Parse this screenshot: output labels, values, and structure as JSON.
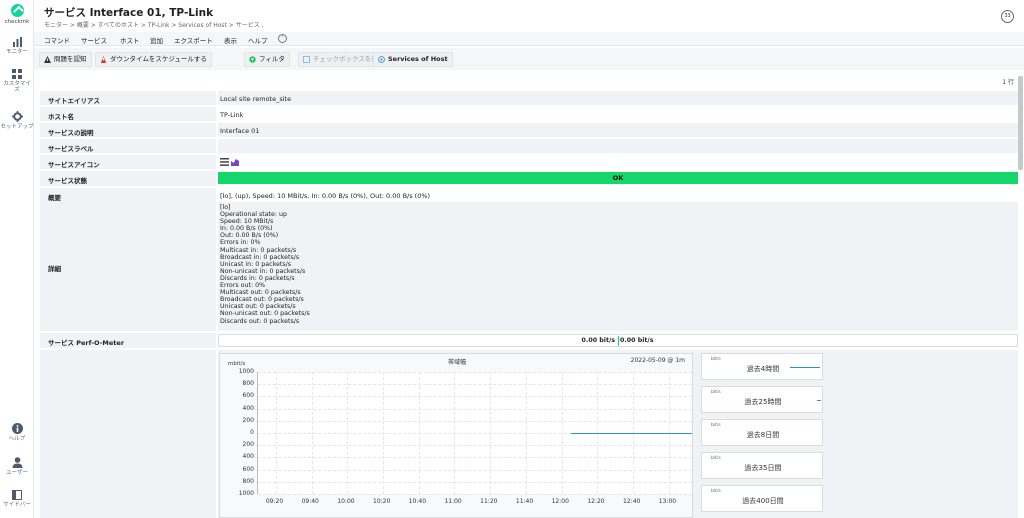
{
  "sidebar": {
    "logo_text": "checkmk",
    "items": [
      {
        "label": "モニター",
        "icon": "bar-chart-icon"
      },
      {
        "label": "カスタマイズ",
        "icon": "grid-icon"
      },
      {
        "label": "セットアップ",
        "icon": "gear-icon"
      },
      {
        "label": "ヘルプ",
        "icon": "info-icon"
      },
      {
        "label": "ユーザー",
        "icon": "user-icon"
      },
      {
        "label": "サイドバー",
        "icon": "sidebar-icon"
      }
    ]
  },
  "header": {
    "title": "サービス Interface 01, TP-Link",
    "breadcrumb": "モニター > 概要 > すべてのホスト > TP-Link > Services of Host > サービス .",
    "timer": "33"
  },
  "menu": {
    "items": [
      "コマンド",
      "サービス",
      "ホスト",
      "追加",
      "エクスポート",
      "表示",
      "ヘルプ"
    ],
    "toggle": "⌃"
  },
  "toolbar": {
    "ack": "問題を認知",
    "downtime": "ダウンタイムをスケジュールする",
    "filter": "フィルタ",
    "checkbox": "チェックボックスを表示する",
    "services_of_host": "Services of Host"
  },
  "row_count": "1 行",
  "table": {
    "site_alias": {
      "label": "サイトエイリアス",
      "value": "Local site remote_site"
    },
    "host_name": {
      "label": "ホスト名",
      "value": "TP-Link"
    },
    "service_desc": {
      "label": "サービスの説明",
      "value": "Interface 01"
    },
    "service_labels": {
      "label": "サービスラベル",
      "value": ""
    },
    "service_icons": {
      "label": "サービスアイコン"
    },
    "service_state": {
      "label": "サービス状態",
      "value": "OK"
    },
    "summary": {
      "label": "概要",
      "value": "[lo], (up), Speed: 10 MBit/s, In: 0.00 B/s (0%), Out: 0.00 B/s (0%)"
    },
    "details": {
      "label": "詳細",
      "lines": [
        "[lo]",
        "Operational state: up",
        "Speed: 10 MBit/s",
        "In: 0.00 B/s (0%)",
        "Out: 0.00 B/s (0%)",
        "Errors in: 0%",
        "Multicast in: 0 packets/s",
        "Broadcast in: 0 packets/s",
        "Unicast in: 0 packets/s",
        "Non-unicast in: 0 packets/s",
        "Discards in: 0 packets/s",
        "Errors out: 0%",
        "Multicast out: 0 packets/s",
        "Broadcast out: 0 packets/s",
        "Unicast out: 0 packets/s",
        "Non-unicast out: 0 packets/s",
        "Discards out: 0 packets/s"
      ]
    },
    "perf_o_meter": {
      "label": "サービス Perf-O-Meter",
      "left": "0.00 bit/s",
      "right": "0.00 bit/s"
    }
  },
  "graph": {
    "title": "帯域幅",
    "date": "2022-05-09 @ 1m",
    "unit": "mbit/s"
  },
  "chart_data": {
    "type": "line",
    "title": "帯域幅",
    "ylabel": "mbit/s",
    "ylim": [
      -1000,
      1000
    ],
    "y_ticks": [
      "1000",
      "800",
      "600",
      "400",
      "200",
      "0",
      "200",
      "400",
      "600",
      "800",
      "1000"
    ],
    "x_ticks": [
      "09:20",
      "09:40",
      "10:00",
      "10:20",
      "10:40",
      "11:00",
      "11:20",
      "11:40",
      "12:00",
      "12:20",
      "12:40",
      "13:00"
    ],
    "series": [
      {
        "x": [
          "12:05",
          "13:15"
        ],
        "values": [
          0,
          0
        ]
      }
    ]
  },
  "mini_graphs": [
    {
      "unit": "bit/s",
      "label": "過去4時間"
    },
    {
      "unit": "bit/s",
      "label": "過去25時間"
    },
    {
      "unit": "bit/s",
      "label": "過去8日間"
    },
    {
      "unit": "bit/s",
      "label": "過去35日間"
    },
    {
      "unit": "bit/s",
      "label": "過去400日間"
    }
  ],
  "colors": {
    "ok": "#15d66a",
    "series": "#2d8fd6",
    "brand": "#15d1a0"
  }
}
